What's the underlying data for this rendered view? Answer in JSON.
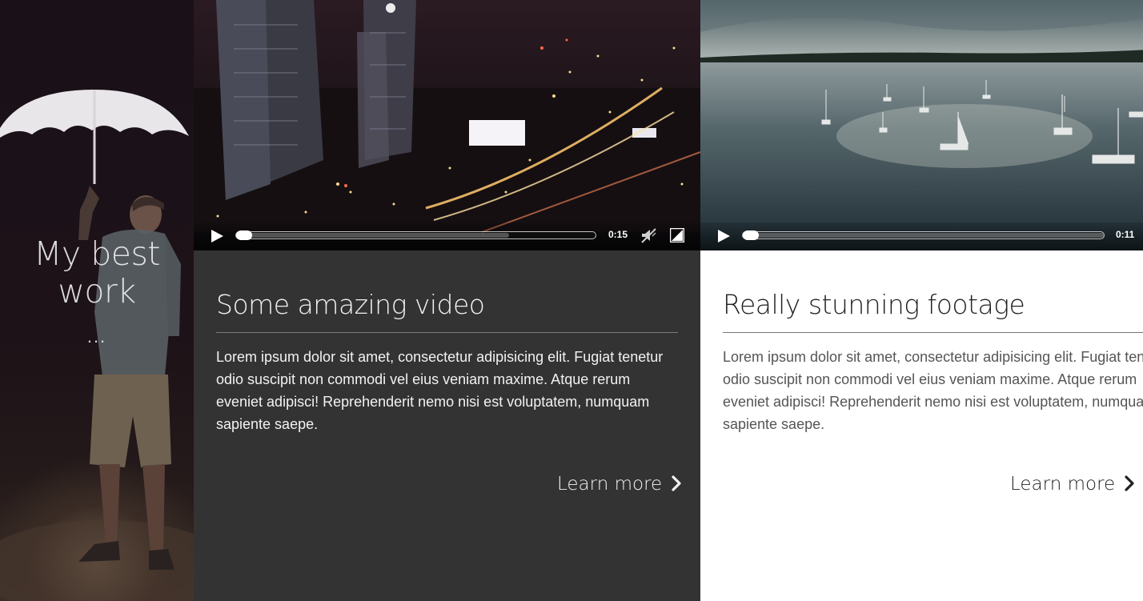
{
  "hero": {
    "title": "My best work",
    "dots": "..."
  },
  "cards": [
    {
      "title": "Some amazing video",
      "text": "Lorem ipsum dolor sit amet, consectetur adipisicing elit. Fugiat tenetur odio suscipit non commodi vel eius veniam maxime. Atque rerum eveniet adipisci! Reprehenderit nemo nisi est voluptatem, numquam sapiente saepe.",
      "link": "Learn more",
      "video": {
        "time": "0:15",
        "progress": 0.0,
        "buffered": 0.76
      }
    },
    {
      "title": "Really stunning footage",
      "text": "Lorem ipsum dolor sit amet, consectetur adipisicing elit. Fugiat tenetur odio suscipit non commodi vel eius veniam maxime. Atque rerum eveniet adipisci! Reprehenderit nemo nisi est voluptatem, numquam sapiente saepe.",
      "link": "Learn more",
      "video": {
        "time": "0:11",
        "progress": 0.0,
        "buffered": 1.0
      }
    }
  ],
  "icons": {
    "play": "play-icon",
    "mute": "volume-mute-icon",
    "fullscreen": "fullscreen-icon",
    "chevron": "chevron-right-icon"
  },
  "colors": {
    "dark_card": "#333333",
    "light_card": "#ffffff",
    "hero_bg": "#1a1018"
  }
}
